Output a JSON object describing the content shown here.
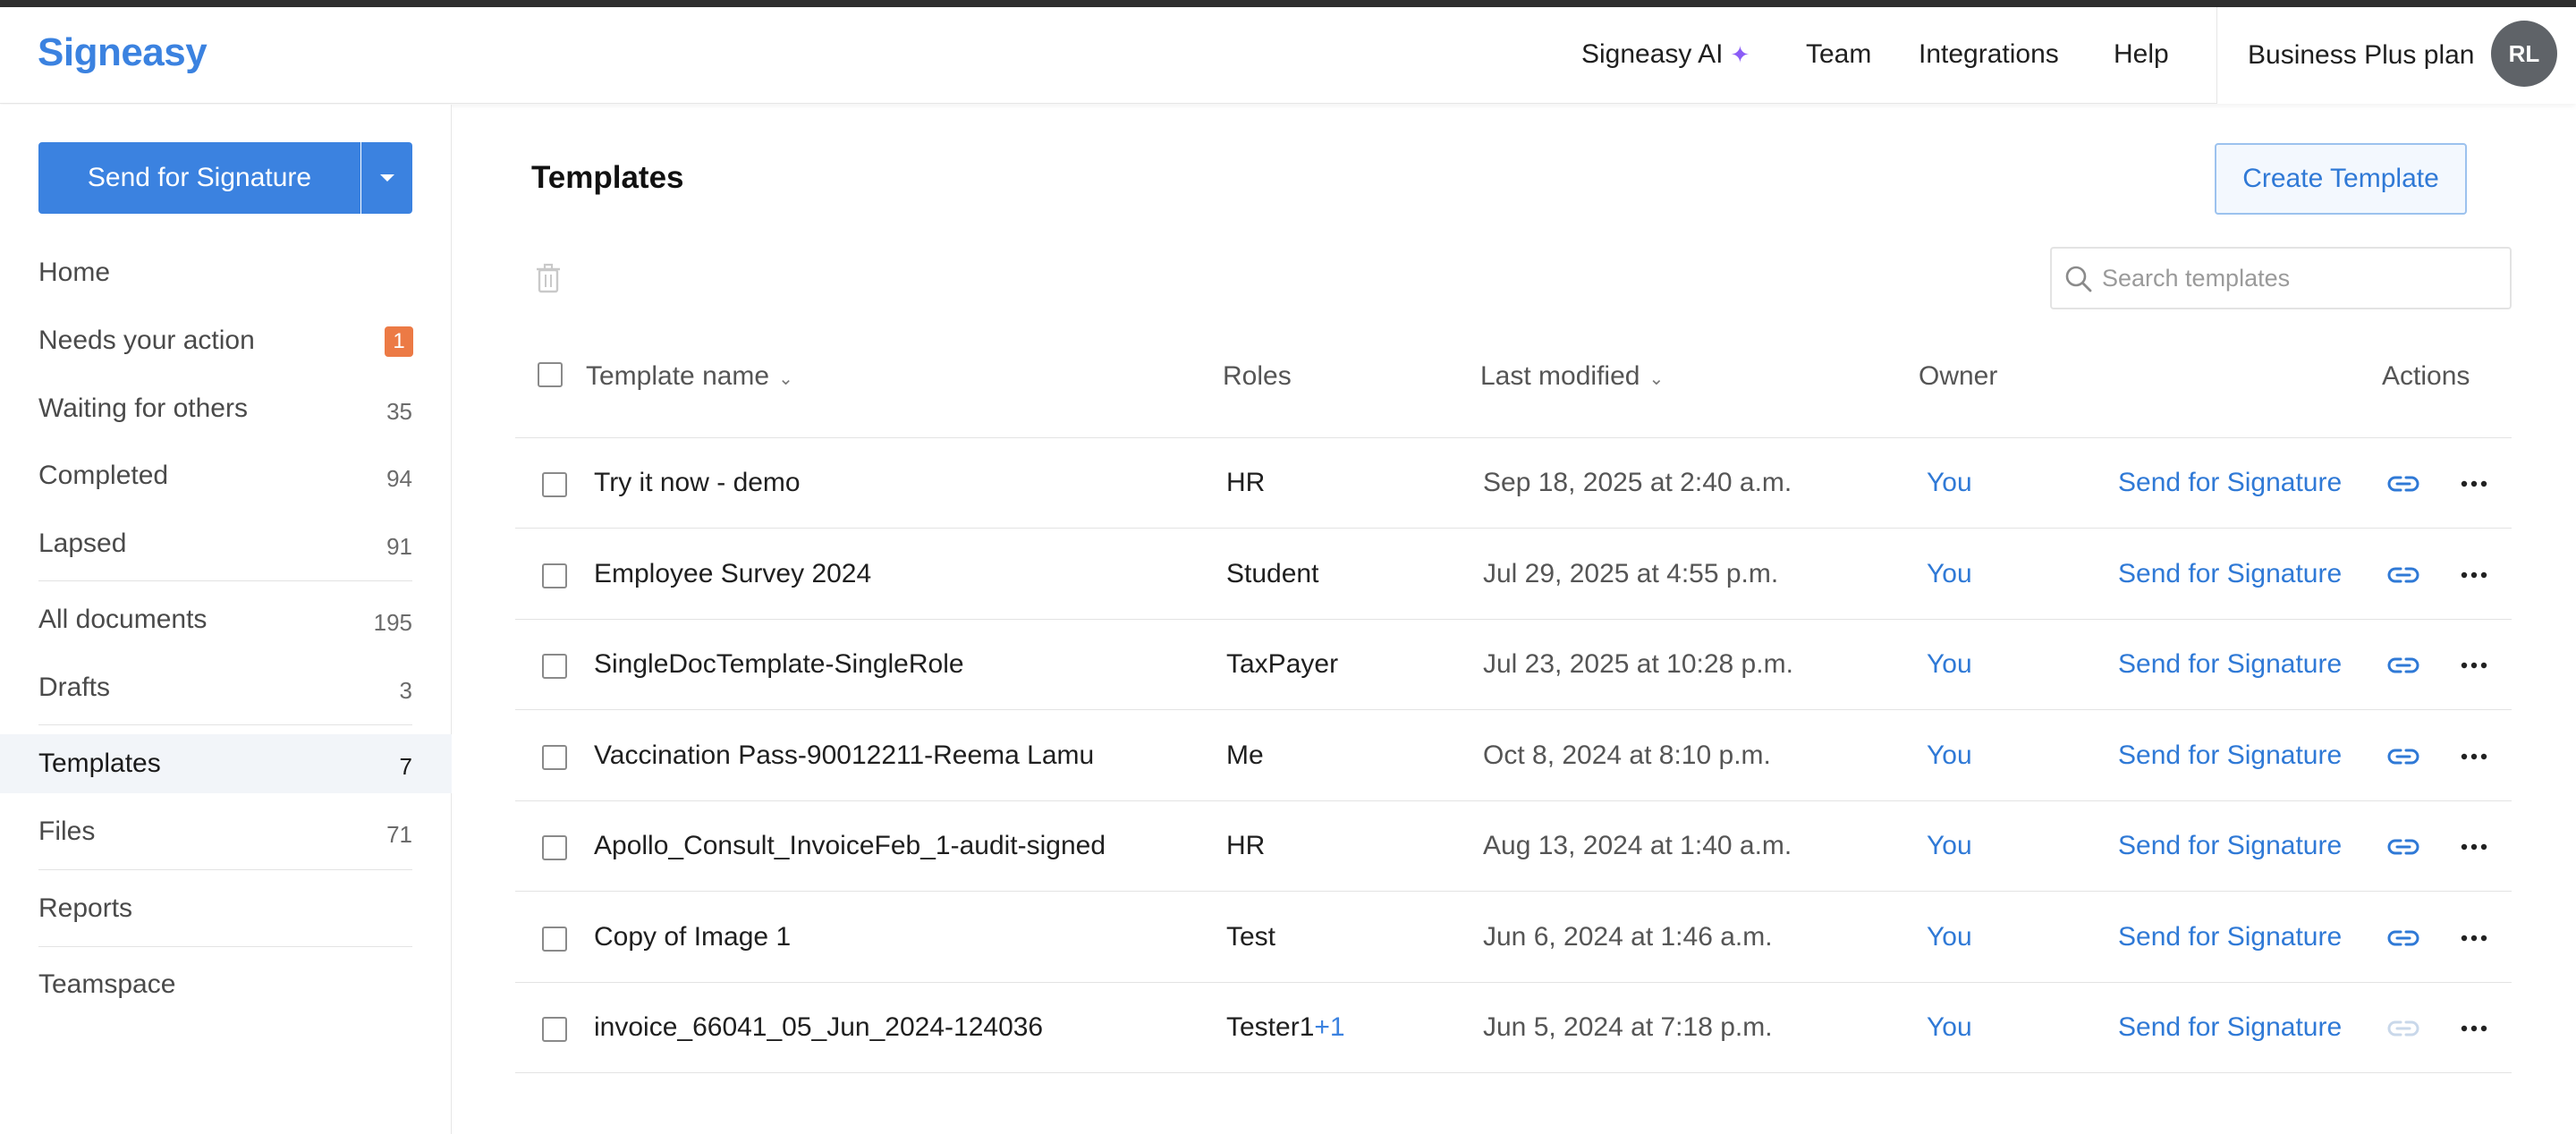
{
  "header": {
    "logo": "Signeasy",
    "nav": [
      {
        "label": "Signeasy AI",
        "icon": "sparkle-icon"
      },
      {
        "label": "Team"
      },
      {
        "label": "Integrations"
      },
      {
        "label": "Help"
      }
    ],
    "plan": "Business Plus plan",
    "avatar_initials": "RL"
  },
  "sidebar": {
    "send_button": "Send for Signature",
    "items": [
      {
        "label": "Home",
        "count": ""
      },
      {
        "label": "Needs your action",
        "count": "1",
        "badge": true
      },
      {
        "label": "Waiting for others",
        "count": "35"
      },
      {
        "label": "Completed",
        "count": "94"
      },
      {
        "label": "Lapsed",
        "count": "91"
      },
      {
        "label": "All documents",
        "count": "195"
      },
      {
        "label": "Drafts",
        "count": "3"
      },
      {
        "label": "Templates",
        "count": "7",
        "active": true
      },
      {
        "label": "Files",
        "count": "71"
      },
      {
        "label": "Reports",
        "count": ""
      },
      {
        "label": "Teamspace",
        "count": ""
      }
    ]
  },
  "main": {
    "title": "Templates",
    "create_button": "Create Template",
    "search_placeholder": "Search templates",
    "columns": {
      "name": "Template name",
      "roles": "Roles",
      "modified": "Last modified",
      "owner": "Owner",
      "actions": "Actions"
    },
    "rows": [
      {
        "name": "Try it now - demo",
        "role": "HR",
        "role_extra": "",
        "modified": "Sep 18, 2025 at 2:40 a.m.",
        "owner": "You",
        "action": "Send for Signature",
        "link_enabled": true
      },
      {
        "name": "Employee Survey 2024",
        "role": "Student",
        "role_extra": "",
        "modified": "Jul 29, 2025 at 4:55 p.m.",
        "owner": "You",
        "action": "Send for Signature",
        "link_enabled": true
      },
      {
        "name": "SingleDocTemplate-SingleRole",
        "role": "TaxPayer",
        "role_extra": "",
        "modified": "Jul 23, 2025 at 10:28 p.m.",
        "owner": "You",
        "action": "Send for Signature",
        "link_enabled": true
      },
      {
        "name": "Vaccination Pass-90012211-Reema Lamu",
        "role": "Me",
        "role_extra": "",
        "modified": "Oct 8, 2024 at 8:10 p.m.",
        "owner": "You",
        "action": "Send for Signature",
        "link_enabled": true
      },
      {
        "name": "Apollo_Consult_InvoiceFeb_1-audit-signed",
        "role": "HR",
        "role_extra": "",
        "modified": "Aug 13, 2024 at 1:40 a.m.",
        "owner": "You",
        "action": "Send for Signature",
        "link_enabled": true
      },
      {
        "name": "Copy of Image 1",
        "role": "Test",
        "role_extra": "",
        "modified": "Jun 6, 2024 at 1:46 a.m.",
        "owner": "You",
        "action": "Send for Signature",
        "link_enabled": true
      },
      {
        "name": "invoice_66041_05_Jun_2024-124036",
        "role": "Tester1",
        "role_extra": "+1",
        "modified": "Jun 5, 2024 at 7:18 p.m.",
        "owner": "You",
        "action": "Send for Signature",
        "link_enabled": false
      }
    ]
  },
  "colors": {
    "brand": "#3b82e0",
    "badge": "#ec7a45",
    "link": "#2f79d6",
    "sparkle": "#8b5cf6"
  }
}
